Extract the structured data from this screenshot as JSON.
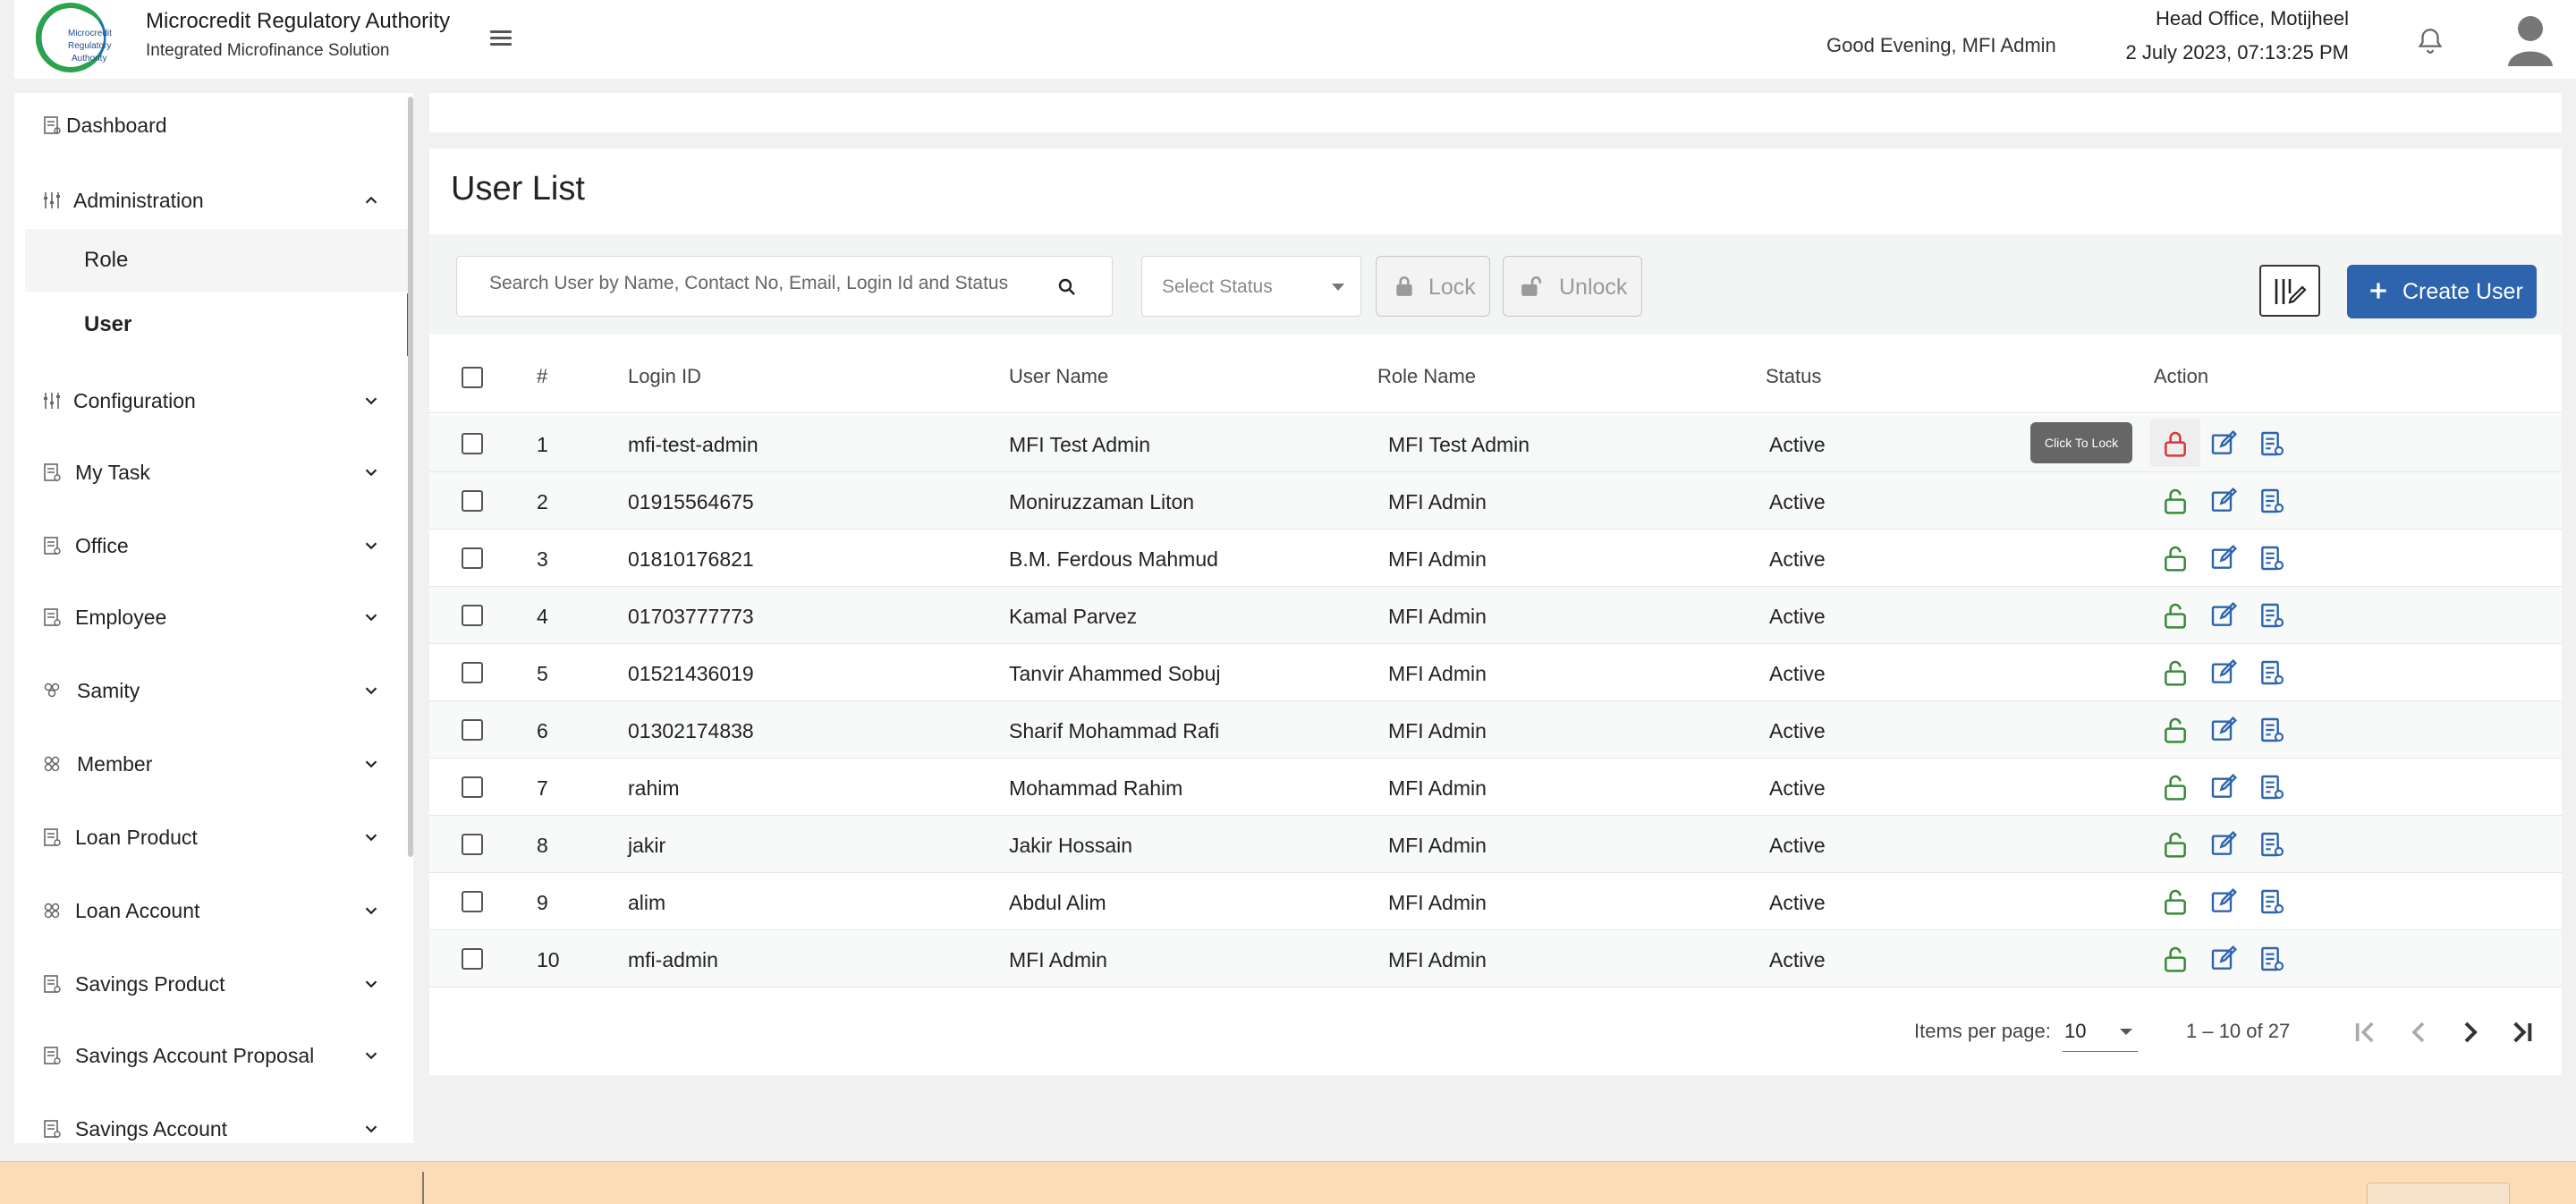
{
  "header": {
    "org_name": "Microcredit Regulatory Authority",
    "org_subtitle": "Integrated Microfinance Solution",
    "logo_text": [
      "Microcredit",
      "Regulatory",
      "Authority"
    ],
    "greeting": "Good Evening, MFI Admin",
    "office": "Head Office, Motijheel",
    "datetime": "2 July 2023, 07:13:25 PM"
  },
  "sidebar": {
    "dashboard": "Dashboard",
    "items": [
      {
        "label": "Administration",
        "icon": "sliders-icon",
        "expanded": true
      },
      {
        "label": "Configuration",
        "icon": "sliders-icon"
      },
      {
        "label": "My Task",
        "icon": "document-icon"
      },
      {
        "label": "Office",
        "icon": "document-icon"
      },
      {
        "label": "Employee",
        "icon": "document-icon"
      },
      {
        "label": "Samity",
        "icon": "group-icon"
      },
      {
        "label": "Member",
        "icon": "group-icon"
      },
      {
        "label": "Loan Product",
        "icon": "document-icon"
      },
      {
        "label": "Loan Account",
        "icon": "group-icon"
      },
      {
        "label": "Savings Product",
        "icon": "document-icon"
      },
      {
        "label": "Savings Account Proposal",
        "icon": "document-icon"
      },
      {
        "label": "Savings Account",
        "icon": "document-icon"
      }
    ],
    "sub_items": [
      {
        "label": "Role"
      },
      {
        "label": "User",
        "active": true
      }
    ]
  },
  "main": {
    "title": "User List",
    "search_placeholder": "Search User by Name, Contact No, Email, Login Id and Status",
    "status_placeholder": "Select Status",
    "lock_label": "Lock",
    "unlock_label": "Unlock",
    "create_label": "Create User",
    "tooltip": "Click To Lock"
  },
  "table": {
    "columns": [
      "#",
      "Login ID",
      "User Name",
      "Role Name",
      "Status",
      "Action"
    ],
    "rows": [
      {
        "n": "1",
        "login": "mfi-test-admin",
        "name": "MFI Test Admin",
        "role": "MFI Test Admin",
        "status": "Active"
      },
      {
        "n": "2",
        "login": "01915564675",
        "name": "Moniruzzaman Liton",
        "role": "MFI Admin",
        "status": "Active"
      },
      {
        "n": "3",
        "login": "01810176821",
        "name": "B.M. Ferdous Mahmud",
        "role": "MFI Admin",
        "status": "Active"
      },
      {
        "n": "4",
        "login": "01703777773",
        "name": "Kamal Parvez",
        "role": "MFI Admin",
        "status": "Active"
      },
      {
        "n": "5",
        "login": "01521436019",
        "name": "Tanvir Ahammed Sobuj",
        "role": "MFI Admin",
        "status": "Active"
      },
      {
        "n": "6",
        "login": "01302174838",
        "name": "Sharif Mohammad Rafi",
        "role": "MFI Admin",
        "status": "Active"
      },
      {
        "n": "7",
        "login": "rahim",
        "name": "Mohammad Rahim",
        "role": "MFI Admin",
        "status": "Active"
      },
      {
        "n": "8",
        "login": "jakir",
        "name": "Jakir Hossain",
        "role": "MFI Admin",
        "status": "Active"
      },
      {
        "n": "9",
        "login": "alim",
        "name": "Abdul Alim",
        "role": "MFI Admin",
        "status": "Active"
      },
      {
        "n": "10",
        "login": "mfi-admin",
        "name": "MFI Admin",
        "role": "MFI Admin",
        "status": "Active"
      }
    ]
  },
  "paginator": {
    "label": "Items per page:",
    "page_size": "10",
    "range": "1 – 10 of 27"
  },
  "colors": {
    "primary": "#2d64ad",
    "lock_green": "#3a8a3a",
    "lock_red": "#d93838",
    "action_blue": "#2d64ad",
    "banner": "#fbdcb7"
  }
}
